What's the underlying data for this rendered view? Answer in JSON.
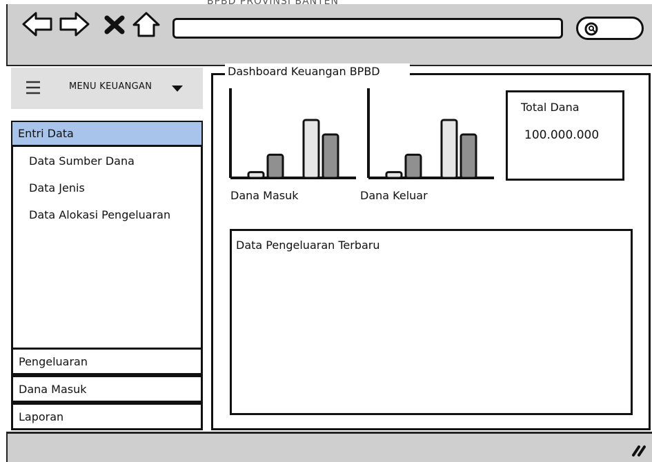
{
  "browser": {
    "title_partial": "BPBD PROVINSI BANTEN",
    "nav_icons": [
      "back-icon",
      "forward-icon",
      "close-icon",
      "home-icon"
    ],
    "search_icon": "search-icon"
  },
  "sidebar": {
    "menu_title": "MENU KEUANGAN",
    "entri": {
      "label": "Entri Data",
      "items": [
        "Data Sumber Dana",
        "Data Jenis",
        "Data Alokasi Pengeluaran"
      ]
    },
    "menu_items": [
      "Pengeluaran",
      "Dana Masuk",
      "Laporan"
    ]
  },
  "dashboard": {
    "title": "Dashboard Keuangan BPBD",
    "total_label": "Total Dana",
    "total_value": "100.000.000",
    "latest_title": "Data Pengeluaran Terbaru"
  },
  "chart_data": [
    {
      "type": "bar",
      "xlabel": "Dana Masuk",
      "series": [
        {
          "values": [
            1,
            4
          ]
        },
        {
          "values": [
            10,
            7.5
          ]
        }
      ],
      "colors": [
        "#e6e6e6",
        "#909090"
      ]
    },
    {
      "type": "bar",
      "xlabel": "Dana Keluar",
      "series": [
        {
          "values": [
            1,
            4
          ]
        },
        {
          "values": [
            10,
            7.5
          ]
        }
      ],
      "colors": [
        "#e6e6e6",
        "#909090"
      ]
    }
  ],
  "colors": {
    "chrome": "#cfcfcf",
    "selected": "#a9c4eb",
    "menu_header": "#e0e0e0"
  }
}
